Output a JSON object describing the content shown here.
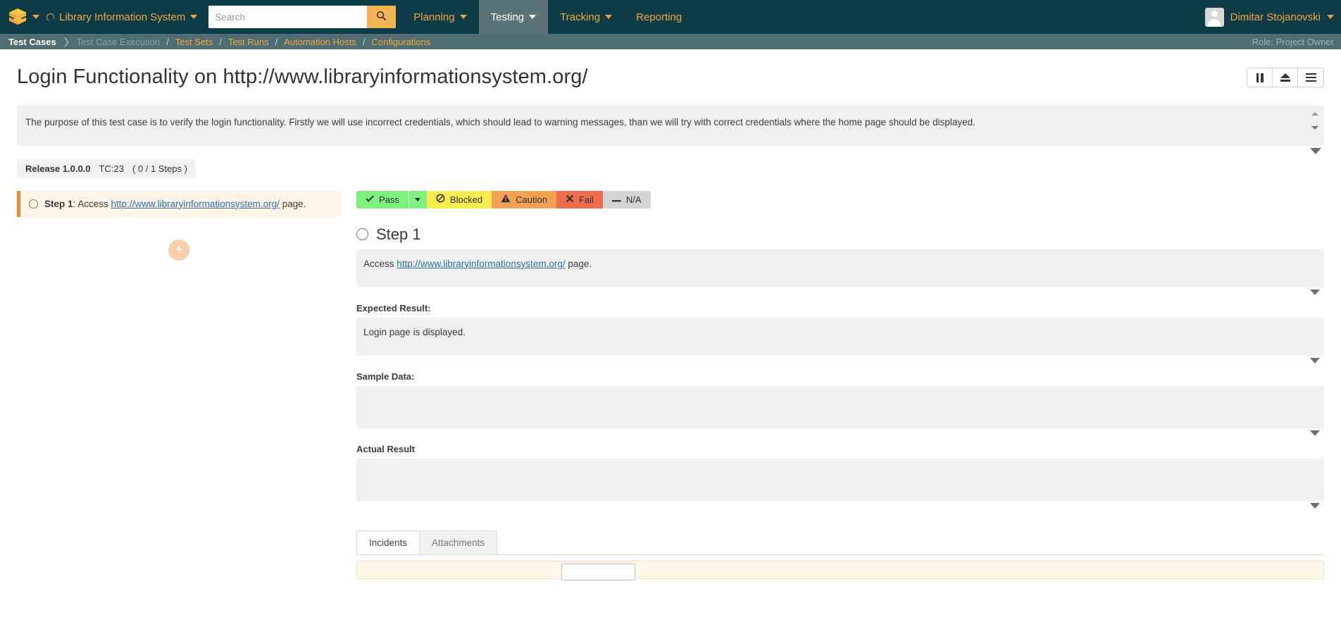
{
  "topbar": {
    "logo_icon": "layers-cube-icon",
    "logo_caret_icon": "chevron-down-icon",
    "project_name": "Library Information System",
    "project_status_icon": "circle-outline-icon",
    "project_caret_icon": "chevron-down-icon",
    "search": {
      "placeholder": "Search",
      "value": "",
      "button_icon": "search-icon"
    },
    "nav": [
      {
        "label": "Planning",
        "has_caret": true,
        "active": false
      },
      {
        "label": "Testing",
        "has_caret": true,
        "active": true
      },
      {
        "label": "Tracking",
        "has_caret": true,
        "active": false
      },
      {
        "label": "Reporting",
        "has_caret": false,
        "active": false
      }
    ],
    "user": {
      "name": "Dimitar Stojanovski",
      "avatar_icon": "user-avatar-icon",
      "caret_icon": "chevron-down-icon"
    },
    "colors": {
      "bar": "#0d3b47",
      "link": "#f4a93d",
      "active_tab": "#5a7278"
    }
  },
  "breadcrumb": {
    "current": "Test Cases",
    "arrow_icon": "chevron-right-icon",
    "items": [
      {
        "label": "Test Case Execution",
        "muted": true
      },
      {
        "label": "Test Sets",
        "muted": false
      },
      {
        "label": "Test Runs",
        "muted": false
      },
      {
        "label": "Automation Hosts",
        "muted": false
      },
      {
        "label": "Configurations",
        "muted": false
      }
    ],
    "separator": "/",
    "role": "Role: Project Owner"
  },
  "page": {
    "title": "Login Functionality on http://www.libraryinformationsystem.org/",
    "actions": [
      {
        "name": "pause-button",
        "icon": "pause-icon"
      },
      {
        "name": "eject-button",
        "icon": "eject-icon"
      },
      {
        "name": "menu-button",
        "icon": "hamburger-menu-icon"
      }
    ],
    "description": "The purpose of this test case is to verify the login functionality. Firstly we will use incorrect credentials, which should lead to warning messages, than we will try with correct credentials where the home page should be displayed.",
    "description_scroll_up_icon": "triangle-up-icon",
    "description_scroll_down_icon": "triangle-down-icon",
    "description_expand_icon": "triangle-down-icon",
    "meta": {
      "release": "Release 1.0.0.0",
      "test_case_id": "TC:23",
      "steps_progress": "( 0 / 1 Steps )"
    }
  },
  "steps_list": {
    "items": [
      {
        "radio_icon": "radio-unchecked-icon",
        "prefix": "Step 1",
        "text_before": ": Access ",
        "link": "http://www.libraryinformationsystem.org/",
        "text_after": " page."
      }
    ],
    "add_label": "+",
    "add_icon": "plus-icon"
  },
  "status_bar": {
    "buttons": [
      {
        "label": "Pass",
        "icon": "check-icon",
        "color": "#7ef07e"
      },
      {
        "label": "Blocked",
        "icon": "no-entry-icon",
        "color": "#f7ec4f"
      },
      {
        "label": "Caution",
        "icon": "warning-triangle-icon",
        "color": "#f2a153"
      },
      {
        "label": "Fail",
        "icon": "x-icon",
        "color": "#ef6c4d"
      },
      {
        "label": "N/A",
        "icon": "minus-icon",
        "color": "#d4d4d4"
      }
    ],
    "pass_caret_icon": "caret-down-icon"
  },
  "step_detail": {
    "heading": "Step 1",
    "heading_radio_icon": "radio-unchecked-icon",
    "description": {
      "text_before": "Access ",
      "link": "http://www.libraryinformationsystem.org/",
      "text_after": " page."
    },
    "expected_result": {
      "label": "Expected Result:",
      "value": "Login page is displayed."
    },
    "sample_data": {
      "label": "Sample Data:",
      "value": ""
    },
    "actual_result": {
      "label": "Actual Result",
      "value": ""
    },
    "expand_icon": "triangle-down-icon"
  },
  "bottom_tabs": {
    "tabs": [
      {
        "label": "Incidents",
        "active": true
      },
      {
        "label": "Attachments",
        "active": false
      }
    ]
  }
}
